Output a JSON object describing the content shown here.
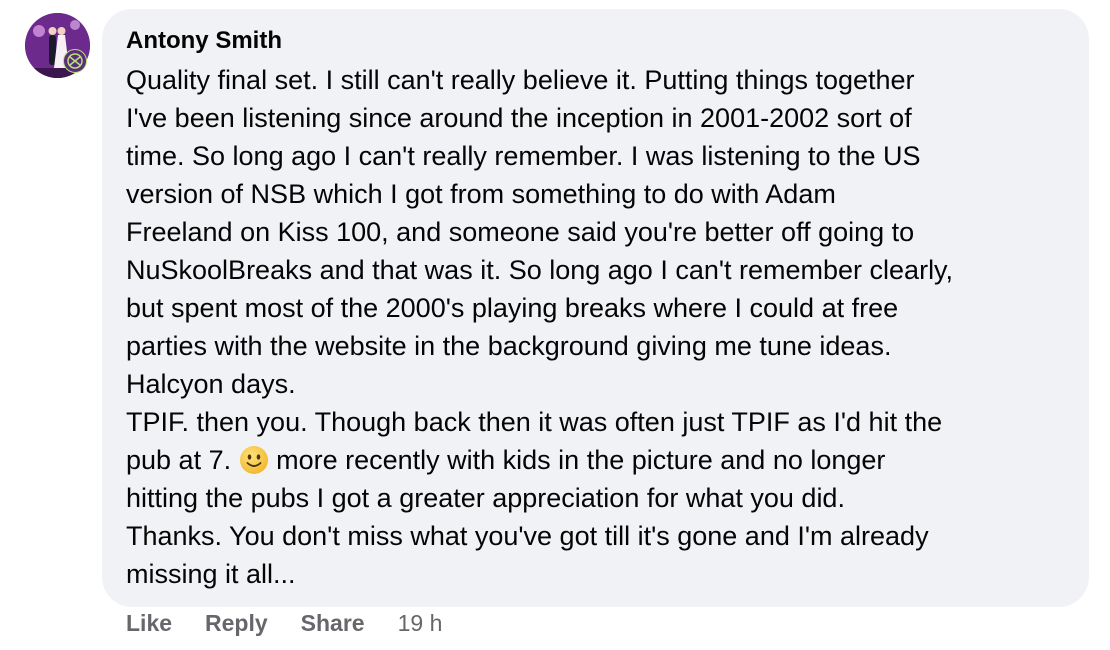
{
  "comment": {
    "author": "Antony Smith",
    "paragraph_lines": [
      "Quality final set. I still can't really believe it. Putting things together",
      "I've been listening since around the inception in 2001-2002 sort of",
      "time. So long ago I can't really remember. I was listening to the US",
      "version of NSB which I got from something to do with Adam",
      "Freeland on Kiss 100, and someone said you're better off going to",
      "NuSkoolBreaks and that was it. So long ago I can't remember clearly,",
      "but spent most of the 2000's playing breaks where I could at free",
      "parties with the website in the background giving me tune ideas.",
      "Halcyon days.",
      "TPIF. then you. Though back then it was often just TPIF as I'd hit the"
    ],
    "line_before_emoji": "pub at 7. ",
    "line_after_emoji": " more recently with kids in the picture and no longer",
    "closing_lines": [
      "hitting the pubs I got a greater appreciation for what you did.",
      "Thanks. You don't miss what you've got till it's gone and I'm already",
      "missing it all..."
    ],
    "emoji": "slightly-smiling-face-icon"
  },
  "actions": {
    "like": "Like",
    "reply": "Reply",
    "share": "Share",
    "time": "19 h"
  },
  "colors": {
    "bubble_bg": "#f0f2f5",
    "text": "#050505",
    "secondary_text": "#65676b",
    "emoji_face": "#f7c843"
  }
}
